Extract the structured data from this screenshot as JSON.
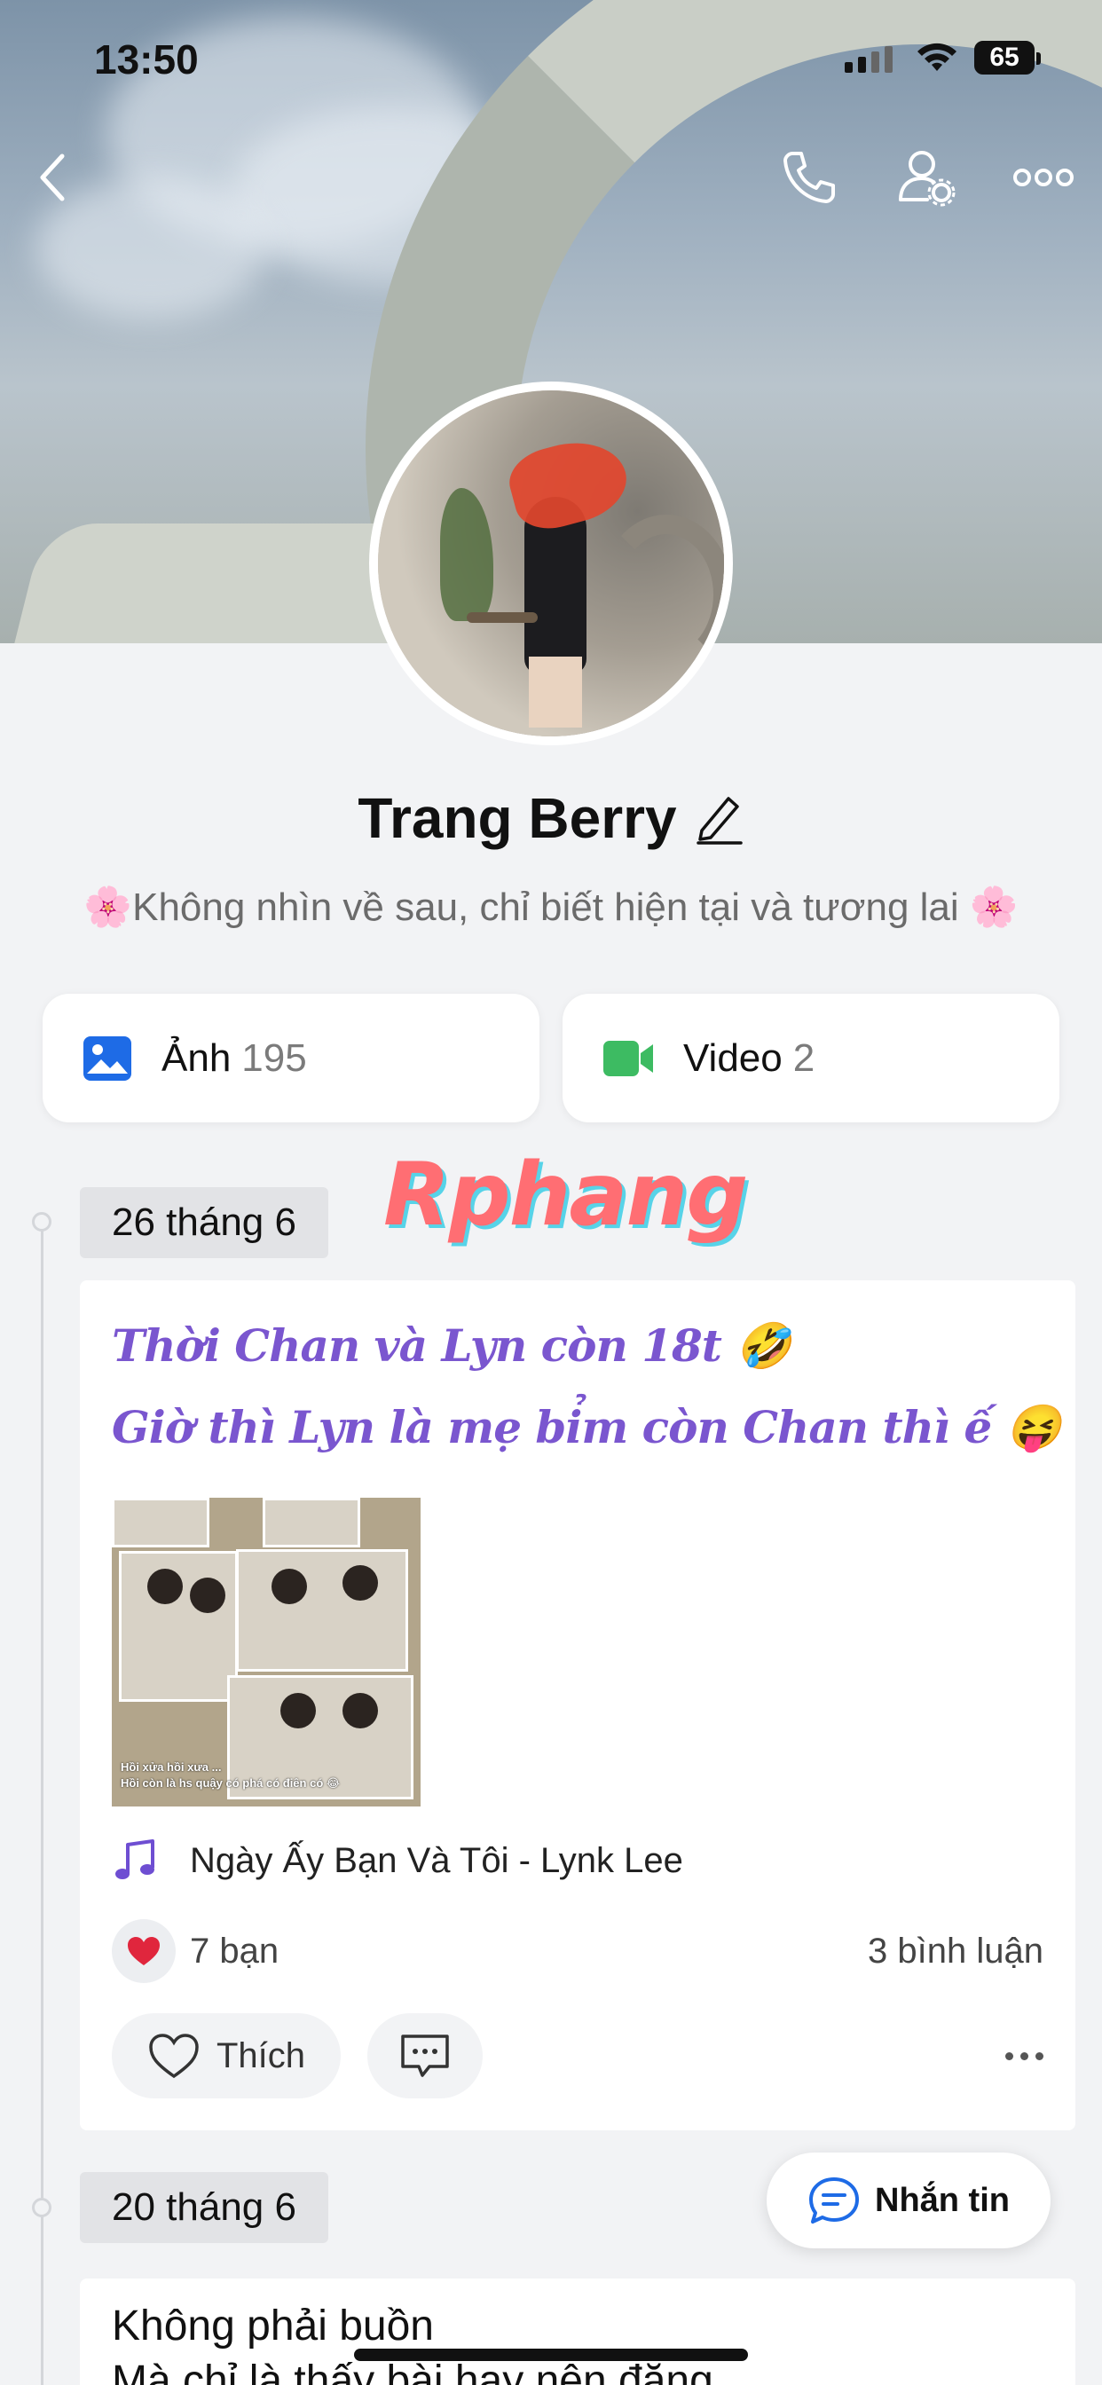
{
  "status_bar": {
    "time": "13:50",
    "battery": "65"
  },
  "header": {
    "back_icon": "chevron-left-icon",
    "call_icon": "phone-icon",
    "profile_settings_icon": "user-gear-icon",
    "more_icon": "more-dots-icon"
  },
  "profile": {
    "name": "Trang Berry",
    "edit_icon": "pencil-icon",
    "bio": "🌸Không nhìn về sau, chỉ biết hiện tại và tương lai 🌸"
  },
  "media": {
    "photos": {
      "label": "Ảnh",
      "count": "195",
      "icon": "image-icon"
    },
    "videos": {
      "label": "Video",
      "count": "2",
      "icon": "video-icon"
    }
  },
  "watermark": "Rphang",
  "timeline": [
    {
      "date": "26 tháng 6",
      "lines": [
        "Thời Chan và Lyn còn 18t 🤣",
        "Giờ thì Lyn là mẹ bỉm còn Chan thì ế 😝"
      ],
      "image_captions": [
        "Hồi xửa hồi xưa ...",
        "Hồi còn là hs quậy có phá có điên có 😂"
      ],
      "music": "Ngày Ấy Bạn Và Tôi - Lynk Lee",
      "reactions": "7 bạn",
      "comments": "3 bình luận",
      "like_label": "Thích"
    },
    {
      "date": "20 tháng 6",
      "lines": [
        "Không phải buồn",
        "Mà chỉ là thấy bài hay nên đăng"
      ]
    }
  ],
  "message_button": {
    "label": "Nhắn tin"
  },
  "colors": {
    "accent_purple": "#7a56cf",
    "blue": "#1e6be6",
    "green": "#3dbb62",
    "heart": "#e0263d"
  }
}
